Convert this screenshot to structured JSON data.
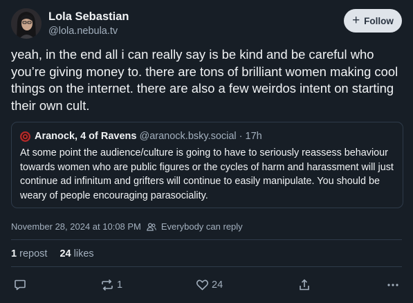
{
  "author": {
    "name": "Lola Sebastian",
    "handle": "@lola.nebula.tv"
  },
  "follow_button": {
    "label": "Follow",
    "icon": "plus-icon"
  },
  "post_text": "yeah, in the end all i can really say is be kind and be careful who you’re giving money to. there are tons of brilliant women making cool things on the internet. there are also a few weirdos intent on starting their own cult.",
  "quoted_post": {
    "author_name": "Aranock, 4 of Ravens",
    "handle": "@aranock.bsky.social",
    "separator": "·",
    "time": "17h",
    "text": "At some point the audience/culture is going to have to seriously reassess behaviour towards women who are public figures or the cycles of harm and harassment will just continue ad infinitum and grifters will continue to easily manipulate. You should be weary of people encouraging parasociality."
  },
  "meta": {
    "timestamp": "November 28, 2024 at 10:08 PM",
    "audience": "Everybody can reply"
  },
  "stats": {
    "reposts_count": "1",
    "reposts_label": "repost",
    "likes_count": "24",
    "likes_label": "likes"
  },
  "actions": {
    "repost_count": "1",
    "like_count": "24"
  },
  "colors": {
    "background": "#171e26",
    "text": "#f1f3f5",
    "muted": "#a3b0be",
    "border": "#2e3b4a",
    "follow_bg": "#dfe4ea",
    "quote_avatar": "#b52a2a"
  }
}
